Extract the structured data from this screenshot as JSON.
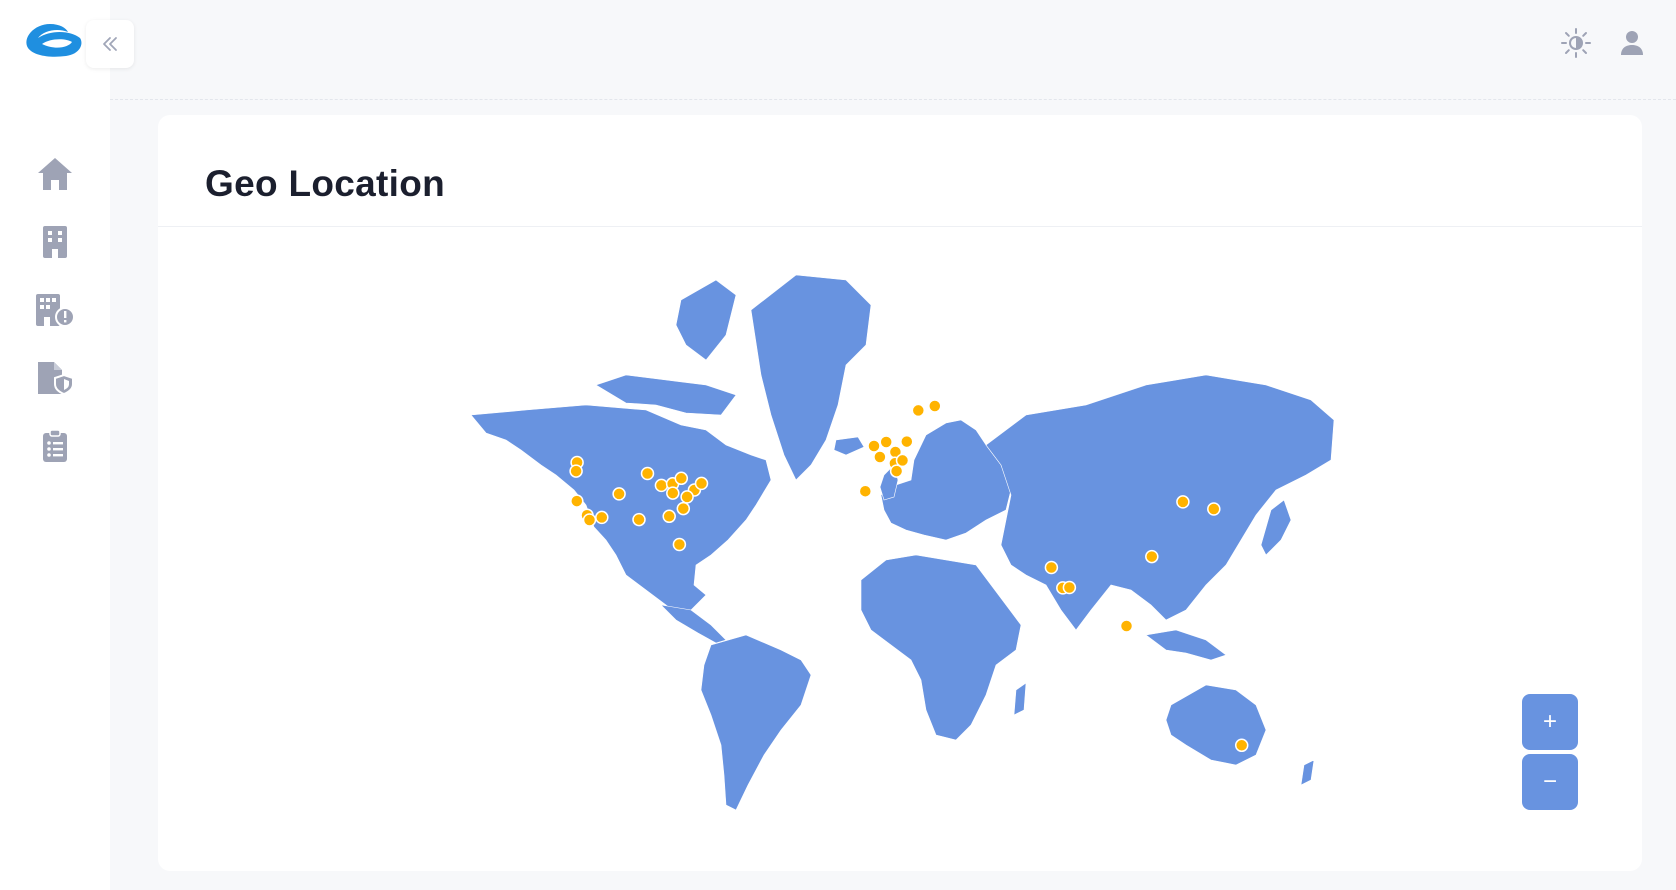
{
  "page": {
    "title": "Geo Location"
  },
  "colors": {
    "map_land": "#6893e0",
    "marker": "#ffb300",
    "marker_stroke": "#ffffff",
    "icon_gray": "#9ea3b5",
    "brand": "#1f8fe0"
  },
  "sidebar": {
    "items": [
      {
        "name": "home",
        "icon": "home-icon"
      },
      {
        "name": "organizations",
        "icon": "building-icon"
      },
      {
        "name": "organization-alerts",
        "icon": "building-alert-icon"
      },
      {
        "name": "policy",
        "icon": "document-shield-icon"
      },
      {
        "name": "reports",
        "icon": "clipboard-list-icon"
      }
    ]
  },
  "topbar": {
    "theme_icon": "sun-icon",
    "user_icon": "user-icon"
  },
  "zoom": {
    "in_label": "+",
    "out_label": "−"
  },
  "map": {
    "projection": "miller",
    "markers": [
      {
        "lat": 47.6,
        "lon": -122.3
      },
      {
        "lat": 45.5,
        "lon": -122.7
      },
      {
        "lat": 37.8,
        "lon": -122.4
      },
      {
        "lat": 34.0,
        "lon": -118.2
      },
      {
        "lat": 32.7,
        "lon": -117.2
      },
      {
        "lat": 33.4,
        "lon": -112.1
      },
      {
        "lat": 39.7,
        "lon": -105.0
      },
      {
        "lat": 32.8,
        "lon": -96.8
      },
      {
        "lat": 41.9,
        "lon": -87.6
      },
      {
        "lat": 44.9,
        "lon": -93.3
      },
      {
        "lat": 42.3,
        "lon": -83.0
      },
      {
        "lat": 39.9,
        "lon": -82.9
      },
      {
        "lat": 40.7,
        "lon": -74.0
      },
      {
        "lat": 42.4,
        "lon": -71.1
      },
      {
        "lat": 38.9,
        "lon": -77.0
      },
      {
        "lat": 35.8,
        "lon": -78.6
      },
      {
        "lat": 33.7,
        "lon": -84.4
      },
      {
        "lat": 25.8,
        "lon": -80.2
      },
      {
        "lat": 43.7,
        "lon": -79.4
      },
      {
        "lat": 51.5,
        "lon": -0.1
      },
      {
        "lat": 48.9,
        "lon": 2.3
      },
      {
        "lat": 52.4,
        "lon": 4.9
      },
      {
        "lat": 50.1,
        "lon": 8.7
      },
      {
        "lat": 47.4,
        "lon": 8.5
      },
      {
        "lat": 48.1,
        "lon": 11.6
      },
      {
        "lat": 52.5,
        "lon": 13.4
      },
      {
        "lat": 59.3,
        "lon": 18.1
      },
      {
        "lat": 60.2,
        "lon": 24.9
      },
      {
        "lat": 40.4,
        "lon": -3.7
      },
      {
        "lat": 45.5,
        "lon": 9.2
      },
      {
        "lat": 19.1,
        "lon": 72.9
      },
      {
        "lat": 13.0,
        "lon": 77.6
      },
      {
        "lat": 13.1,
        "lon": 80.3
      },
      {
        "lat": 1.35,
        "lon": 103.8
      },
      {
        "lat": 22.3,
        "lon": 114.2
      },
      {
        "lat": 37.6,
        "lon": 127.0
      },
      {
        "lat": 35.7,
        "lon": 139.7
      },
      {
        "lat": -33.9,
        "lon": 151.2
      }
    ]
  }
}
